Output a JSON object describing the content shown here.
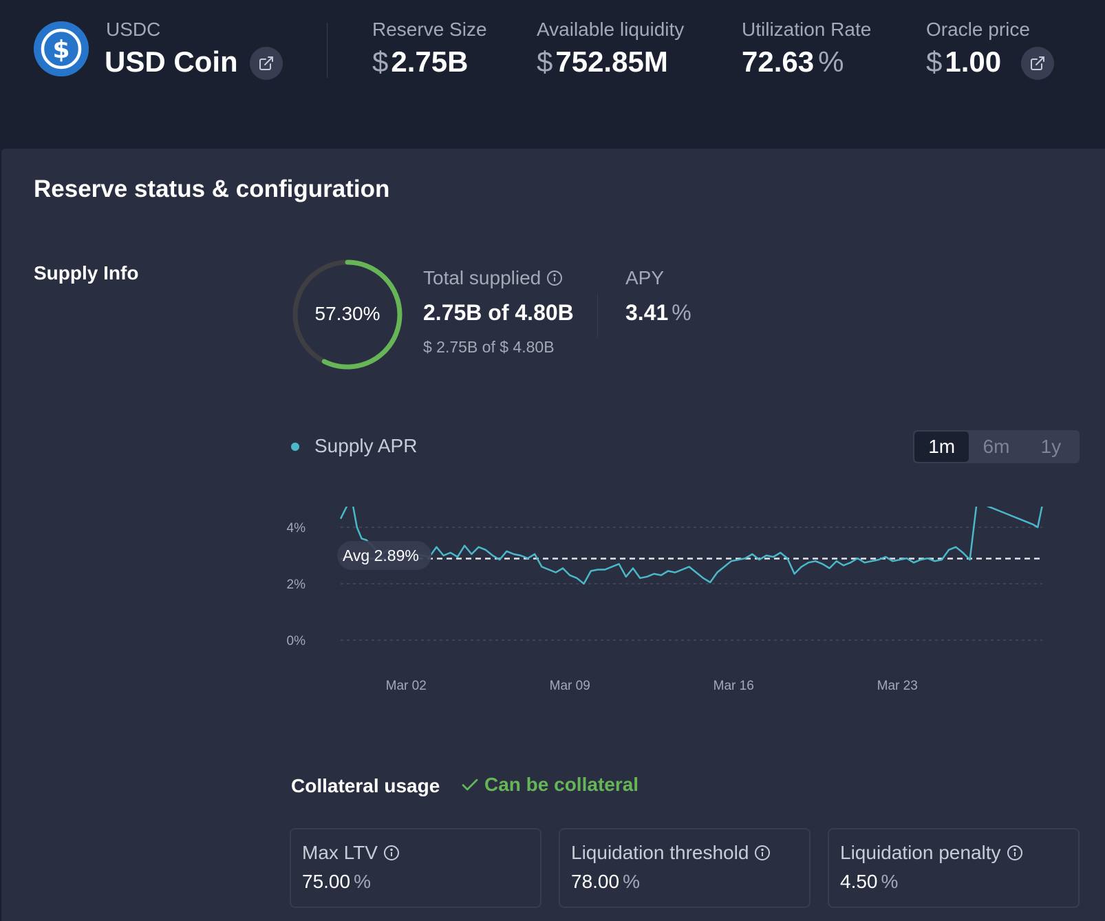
{
  "header": {
    "symbol": "USDC",
    "name": "USD Coin",
    "stats": [
      {
        "label": "Reserve Size",
        "prefix": "$",
        "value": "2.75B",
        "suffix": ""
      },
      {
        "label": "Available liquidity",
        "prefix": "$",
        "value": "752.85M",
        "suffix": ""
      },
      {
        "label": "Utilization Rate",
        "prefix": "",
        "value": "72.63",
        "suffix": "%"
      },
      {
        "label": "Oracle price",
        "prefix": "$",
        "value": "1.00",
        "suffix": ""
      }
    ]
  },
  "section_title": "Reserve status & configuration",
  "supply_info": {
    "title": "Supply Info",
    "donut_label": "57.30%",
    "donut_fraction": 0.573,
    "total_supplied_label": "Total supplied",
    "total_supplied_value": "2.75B of 4.80B",
    "total_supplied_usd": "$ 2.75B of $ 4.80B",
    "apy_label": "APY",
    "apy_value": "3.41",
    "apy_suffix": "%"
  },
  "chart": {
    "legend": "Supply APR",
    "ranges": [
      "1m",
      "6m",
      "1y"
    ],
    "active_range": "1m",
    "avg_label": "Avg 2.89%"
  },
  "chart_data": {
    "type": "line",
    "title": "",
    "xlabel": "",
    "ylabel": "",
    "y_ticks": [
      "0%",
      "2%",
      "4%"
    ],
    "x_ticks": [
      {
        "label": "Mar 02",
        "day": 2
      },
      {
        "label": "Mar 09",
        "day": 9
      },
      {
        "label": "Mar 16",
        "day": 16
      },
      {
        "label": "Mar 23",
        "day": 23
      }
    ],
    "ylim": [
      0,
      4.5
    ],
    "xlim": [
      -0.8,
      29.2
    ],
    "average": 2.89,
    "series": [
      {
        "name": "Supply APR",
        "color": "#4bb8c9",
        "x": [
          -0.8,
          -0.5,
          -0.3,
          -0.1,
          0.1,
          0.3,
          0.6,
          0.9,
          1.2,
          1.5,
          1.8,
          2.1,
          2.4,
          2.7,
          3.0,
          3.3,
          3.6,
          3.9,
          4.2,
          4.5,
          4.8,
          5.1,
          5.4,
          5.7,
          6.0,
          6.3,
          6.6,
          6.9,
          7.2,
          7.5,
          7.8,
          8.1,
          8.4,
          8.7,
          9.0,
          9.3,
          9.6,
          9.9,
          10.2,
          10.5,
          10.8,
          11.1,
          11.4,
          11.7,
          12.0,
          12.3,
          12.6,
          12.9,
          13.2,
          13.5,
          13.8,
          14.1,
          14.4,
          14.7,
          15.0,
          15.3,
          15.6,
          15.9,
          16.2,
          16.5,
          16.8,
          17.1,
          17.4,
          17.7,
          18.0,
          18.3,
          18.6,
          18.9,
          19.2,
          19.5,
          19.8,
          20.1,
          20.4,
          20.7,
          21.0,
          21.3,
          21.6,
          21.9,
          22.2,
          22.5,
          22.8,
          23.1,
          23.4,
          23.7,
          24.0,
          24.3,
          24.6,
          24.9,
          25.2,
          25.5,
          25.8,
          26.1,
          26.4,
          26.7,
          27.0,
          27.3,
          27.6,
          27.9,
          28.2,
          28.5,
          28.8,
          29.0,
          29.2
        ],
        "y": [
          4.3,
          4.8,
          4.9,
          4.0,
          3.6,
          3.55,
          3.3,
          3.0,
          3.2,
          3.0,
          2.95,
          3.1,
          3.05,
          3.0,
          2.95,
          3.3,
          3.0,
          3.1,
          2.95,
          3.35,
          3.05,
          3.3,
          3.2,
          3.0,
          2.85,
          3.15,
          3.05,
          3.0,
          2.9,
          3.05,
          2.6,
          2.5,
          2.4,
          2.55,
          2.3,
          2.2,
          2.0,
          2.45,
          2.5,
          2.5,
          2.6,
          2.7,
          2.25,
          2.55,
          2.2,
          2.25,
          2.35,
          2.3,
          2.45,
          2.4,
          2.5,
          2.6,
          2.4,
          2.2,
          2.05,
          2.4,
          2.6,
          2.8,
          2.85,
          2.9,
          3.05,
          2.85,
          3.0,
          2.95,
          3.1,
          2.9,
          2.35,
          2.6,
          2.75,
          2.8,
          2.7,
          2.55,
          2.8,
          2.65,
          2.75,
          2.9,
          2.75,
          2.8,
          2.85,
          2.95,
          2.8,
          2.85,
          2.9,
          2.75,
          2.85,
          2.9,
          2.8,
          2.85,
          3.2,
          3.3,
          3.1,
          2.85,
          4.9,
          4.8,
          4.7,
          4.6,
          4.5,
          4.4,
          4.3,
          4.2,
          4.1,
          4.0,
          4.8
        ]
      }
    ]
  },
  "collateral": {
    "title": "Collateral usage",
    "status": "Can be collateral",
    "status_color": "#66b556",
    "params": [
      {
        "label": "Max LTV",
        "value": "75.00",
        "suffix": "%"
      },
      {
        "label": "Liquidation threshold",
        "value": "78.00",
        "suffix": "%"
      },
      {
        "label": "Liquidation penalty",
        "value": "4.50",
        "suffix": "%"
      }
    ]
  },
  "icons": {
    "asset_logo": "usdc-coin-icon",
    "external_link": "external-link-icon",
    "info": "info-circle-icon",
    "check": "check-icon"
  }
}
